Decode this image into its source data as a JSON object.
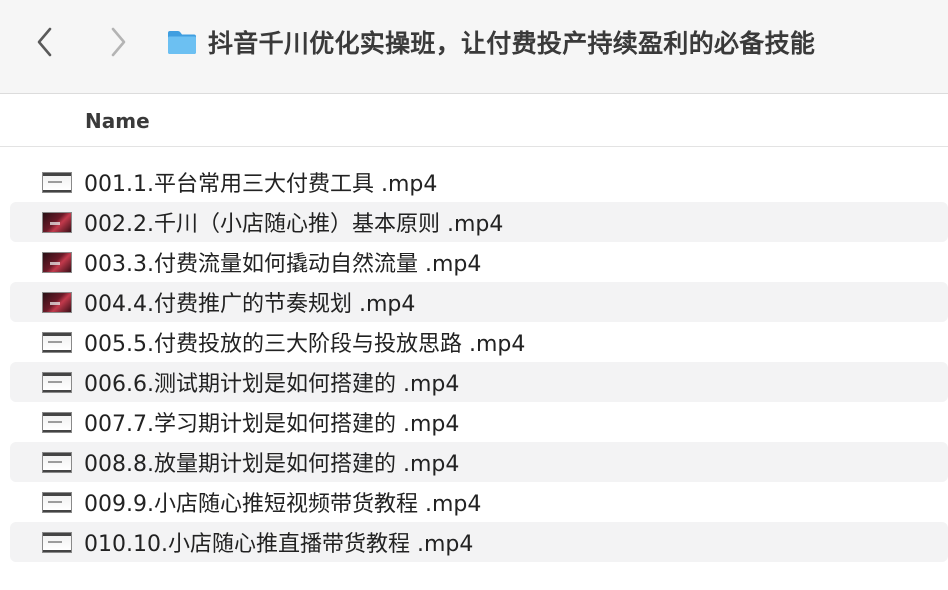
{
  "window": {
    "title": "抖音千川优化实操班，让付费投产持续盈利的必备技能"
  },
  "columns": {
    "name": "Name"
  },
  "files": [
    {
      "name": "001.1.平台常用三大付费工具 .mp4",
      "thumbnail": "light"
    },
    {
      "name": "002.2.千川（小店随心推）基本原则 .mp4",
      "thumbnail": "dark"
    },
    {
      "name": "003.3.付费流量如何撬动自然流量 .mp4",
      "thumbnail": "dark"
    },
    {
      "name": "004.4.付费推广的节奏规划 .mp4",
      "thumbnail": "dark"
    },
    {
      "name": "005.5.付费投放的三大阶段与投放思路 .mp4",
      "thumbnail": "light"
    },
    {
      "name": "006.6.测试期计划是如何搭建的 .mp4",
      "thumbnail": "light"
    },
    {
      "name": "007.7.学习期计划是如何搭建的 .mp4",
      "thumbnail": "light"
    },
    {
      "name": "008.8.放量期计划是如何搭建的 .mp4",
      "thumbnail": "light"
    },
    {
      "name": "009.9.小店随心推短视频带货教程 .mp4",
      "thumbnail": "light"
    },
    {
      "name": "010.10.小店随心推直播带货教程 .mp4",
      "thumbnail": "light"
    }
  ],
  "icons": {
    "back": "chevron-left-icon",
    "forward": "chevron-right-icon",
    "folder": "folder-icon"
  },
  "colors": {
    "folder": "#5ab4ec",
    "alt_row": "#f3f3f4"
  }
}
